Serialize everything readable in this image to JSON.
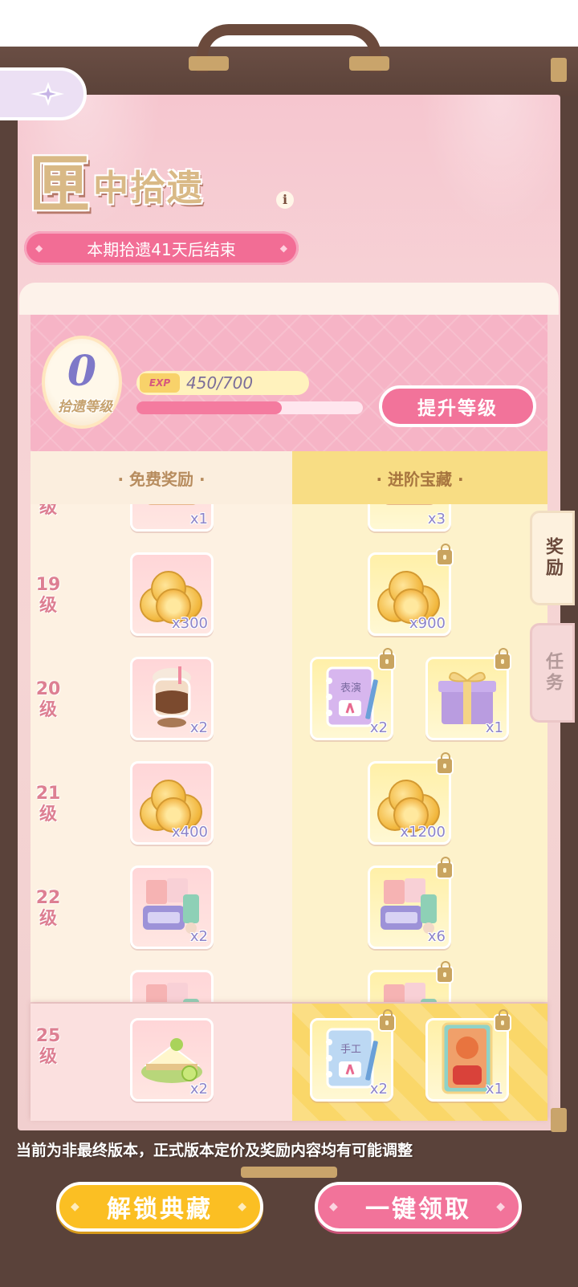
{
  "header": {
    "title_main": "匣",
    "title_rest": "中拾遗",
    "info_icon": "i",
    "period_text": "本期拾遗41天后结束"
  },
  "level_panel": {
    "level_value": "0",
    "level_label": "拾遗等级",
    "exp_tag": "EXP",
    "exp_text": "450/700",
    "exp_progress": 0.643,
    "upgrade_label": "提升等级"
  },
  "columns": {
    "free_header": "· 免费奖励 ·",
    "advanced_header": "· 进阶宝藏 ·"
  },
  "side_tabs": {
    "rewards": "奖励",
    "tasks": "任务"
  },
  "rewards": [
    {
      "level": "级",
      "free": {
        "icon": "puppet-icon",
        "qty": "x1"
      },
      "advanced": [
        {
          "icon": "puppet-icon",
          "qty": "x3"
        }
      ]
    },
    {
      "level": "19级",
      "free": {
        "icon": "coins-icon",
        "qty": "x300"
      },
      "advanced": [
        {
          "icon": "coins-icon",
          "qty": "x900"
        }
      ]
    },
    {
      "level": "20级",
      "free": {
        "icon": "coffee-icon",
        "qty": "x2"
      },
      "advanced": [
        {
          "icon": "performance-notebook-icon",
          "qty": "x2"
        },
        {
          "icon": "gift-box-icon",
          "qty": "x1"
        }
      ]
    },
    {
      "level": "21级",
      "free": {
        "icon": "coins-icon",
        "qty": "x400"
      },
      "advanced": [
        {
          "icon": "coins-icon",
          "qty": "x1200"
        }
      ]
    },
    {
      "level": "22级",
      "free": {
        "icon": "makeup-kit-icon",
        "qty": "x2"
      },
      "advanced": [
        {
          "icon": "makeup-kit-icon",
          "qty": "x6"
        }
      ]
    }
  ],
  "preview_reward": {
    "level": "25级",
    "free": {
      "icon": "cake-icon",
      "qty": "x2"
    },
    "advanced": [
      {
        "icon": "craft-notebook-icon",
        "qty": "x2"
      },
      {
        "icon": "character-card-icon",
        "qty": "x1"
      }
    ]
  },
  "notebook_labels": {
    "performance": "表演",
    "craft": "手工"
  },
  "notice": "当前为非最终版本，正式版本定价及奖励内容均有可能调整",
  "buttons": {
    "unlock": "解锁典藏",
    "claim_all": "一键领取"
  },
  "colors": {
    "pink_accent": "#f2739a",
    "gold_accent": "#fbbf23",
    "frame_brown": "#5a423a"
  }
}
